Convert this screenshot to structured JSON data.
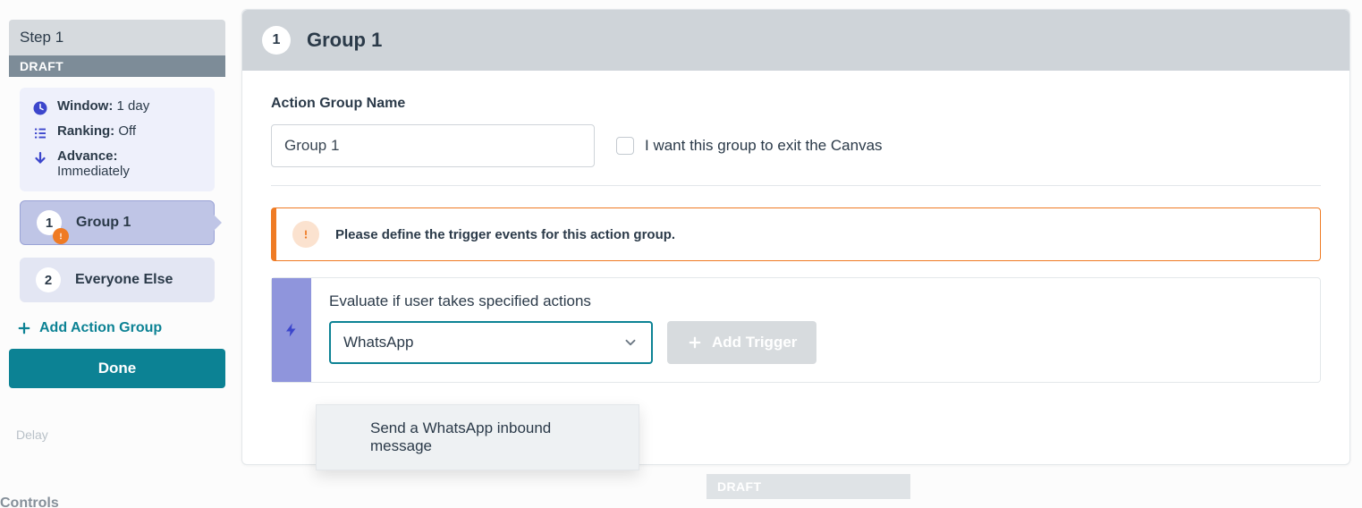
{
  "sidebar": {
    "step_label": "Step 1",
    "draft_label": "DRAFT",
    "info": {
      "window_label": "Window:",
      "window_value": "1 day",
      "ranking_label": "Ranking:",
      "ranking_value": "Off",
      "advance_label": "Advance:",
      "advance_value": "Immediately"
    },
    "groups": [
      {
        "number": "1",
        "label": "Group 1",
        "active": true,
        "has_warning": true
      },
      {
        "number": "2",
        "label": "Everyone Else",
        "active": false,
        "has_warning": false
      }
    ],
    "add_group_label": "Add Action Group",
    "done_label": "Done"
  },
  "background": {
    "delay_label": "Delay",
    "controls_label": "Controls"
  },
  "main": {
    "header_number": "1",
    "header_title": "Group 1",
    "name_field_label": "Action Group Name",
    "name_field_value": "Group 1",
    "exit_checkbox_label": "I want this group to exit the Canvas",
    "alert_message": "Please define the trigger events for this action group.",
    "evaluate_label": "Evaluate if user takes specified actions",
    "select_value": "WhatsApp",
    "add_trigger_label": "Add Trigger",
    "dropdown_option": "Send a WhatsApp inbound message",
    "bottom_pill": "DRAFT"
  }
}
